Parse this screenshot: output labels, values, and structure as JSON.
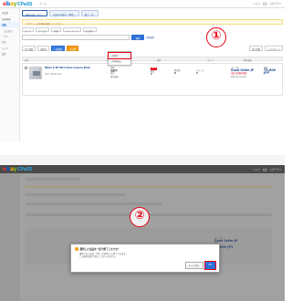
{
  "brand": {
    "e1": "e",
    "e2": "b",
    "e3": "a",
    "e4": "y",
    "suffix": "CPaSS"
  },
  "colors": {
    "accent": "#2f6fd6",
    "annotation": "#e60012",
    "warn_bg": "#fffbe6",
    "bulk_button": "#3b7ddd",
    "alt_button": "#f39c12"
  },
  "panel1": {
    "top_mini": "ホーム",
    "top_right": [
      "ヘルプ",
      "設定",
      "ログアウト"
    ],
    "marker": "①",
    "sidebar": [
      "出品者",
      "在庫管理",
      "出品",
      "出品管理",
      "CSV",
      "注文",
      "ストア",
      "設定"
    ],
    "tabs": [
      "eBay出品（全て）",
      "出品中の商品（48件）",
      "終了（0）"
    ],
    "warning": "アカウントの状態を確認してください",
    "filters": [
      "ストア",
      "カテゴリ",
      "状態",
      "フォーマット",
      "並び替え"
    ],
    "search": {
      "placeholder": "キーワード",
      "button": "検索",
      "link": "詳細検索"
    },
    "actions": [
      "全て選択",
      "選択中",
      "一括操作",
      "その他"
    ],
    "actions_right": [
      "表示件数",
      "エクスポート"
    ],
    "dropdown": [
      "一括終了",
      "一括再出品"
    ],
    "table_headers": [
      "商品",
      "在庫",
      "価格",
      "ストア",
      "販売価格"
    ],
    "listing": {
      "title": "Nikon Z 6II Mirrorless Camera Body",
      "sub": "SKU: NK-Z6-002",
      "status_label": "状態",
      "status_value": "出品中",
      "status_tag": "NEW",
      "qty_label": "数量",
      "qty_value": "1",
      "sold_label": "販売数",
      "sold_value": "0",
      "watch_label": "ウォッチ",
      "watch_value": "3",
      "format_label": "形式",
      "format_value": "固定価格",
      "store_label": "ストア名",
      "store_name": "Good Seller JP",
      "store_link": "出品の詳細を確認",
      "store_note": "ship via courier",
      "price_label": "価格",
      "price_value": "74,800 JPY"
    }
  },
  "panel2": {
    "marker": "②",
    "top_right": [
      "ヘルプ",
      "設定",
      "ログアウト"
    ],
    "modal": {
      "title": "選択した出品を一括で終了しますか？",
      "line1": "選択された出品（1件）がeBay上で終了されます。",
      "line2": "この操作は取り消すことができません。",
      "cancel": "キャンセル",
      "ok": "OK"
    },
    "side": {
      "store_label": "ストア名",
      "store_name": "Good Seller JP",
      "price_label": "価格",
      "price_value": "74,800 JPY"
    }
  }
}
